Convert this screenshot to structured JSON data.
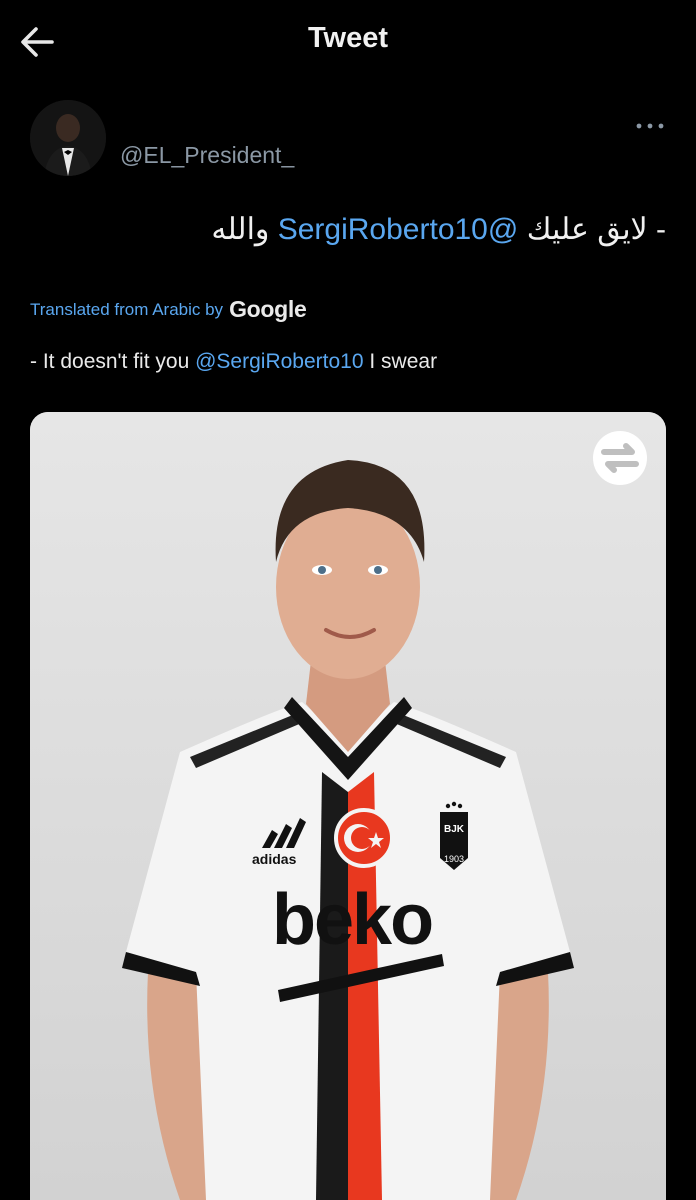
{
  "header": {
    "title": "Tweet",
    "back_icon": "arrow-left-icon"
  },
  "tweet": {
    "handle": "@EL_President_",
    "more_icon": "more-horizontal-icon",
    "arabic": {
      "prefix": "- لايق عليك",
      "mention": "@SergiRoberto10",
      "suffix": "والله"
    },
    "translated_label": "Translated from Arabic by",
    "translation_provider": "Google",
    "english": {
      "prefix": "- It doesn't fit you",
      "mention": "@SergiRoberto10",
      "suffix": "I swear"
    }
  },
  "media": {
    "brand_sponsor": "beko",
    "brand_kit": "adidas",
    "crest_letters": "BJK",
    "crest_year": "1903",
    "overlay_icon": "swap-arrows-icon"
  },
  "colors": {
    "background": "#000000",
    "link": "#5aa7f0",
    "secondary_text": "#8b98a5",
    "stripe_red": "#e8381f",
    "stripe_black": "#1a1a1a"
  }
}
